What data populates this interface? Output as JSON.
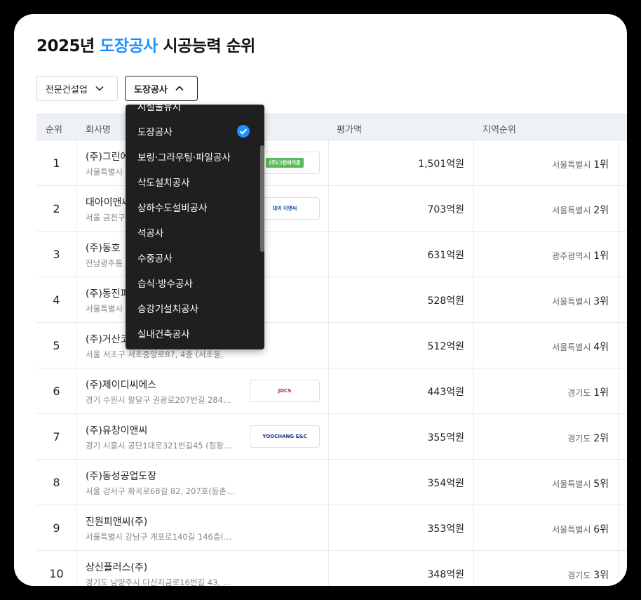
{
  "title": {
    "year": "2025년",
    "category": "도장공사",
    "suffix": "시공능력 순위"
  },
  "filters": {
    "industry": "전문건설업",
    "category": "도장공사"
  },
  "table": {
    "headers": {
      "rank": "순위",
      "company": "회사명",
      "amount": "평가액",
      "region_rank": "지역순위"
    },
    "rows": [
      {
        "rank": "1",
        "name": "(주)그린에",
        "addr": "서울특별시",
        "logo": "(주)그린에이존",
        "amount": "1,501억원",
        "region": "서울특별시",
        "region_rank": "1위"
      },
      {
        "rank": "2",
        "name": "대아이앤씨",
        "addr": "서울 금천구",
        "logo": "대아 이앤씨",
        "amount": "703억원",
        "region": "서울특별시",
        "region_rank": "2위"
      },
      {
        "rank": "3",
        "name": "(주)동호",
        "addr": "전남광주통",
        "logo": "",
        "amount": "631억원",
        "region": "광주광역시",
        "region_rank": "1위"
      },
      {
        "rank": "4",
        "name": "(주)동진피",
        "addr": "서울특별시",
        "logo": "",
        "amount": "528억원",
        "region": "서울특별시",
        "region_rank": "3위"
      },
      {
        "rank": "5",
        "name": "(주)거산코",
        "addr": "서울 서초구 서초중앙로87, 4층 (서초동,",
        "logo": "",
        "amount": "512억원",
        "region": "서울특별시",
        "region_rank": "4위"
      },
      {
        "rank": "6",
        "name": "(주)제이디씨에스",
        "addr": "경기 수원시 팔달구 권광로207번길 284…",
        "logo": "JDCS",
        "amount": "443억원",
        "region": "경기도",
        "region_rank": "1위"
      },
      {
        "rank": "7",
        "name": "(주)유창이앤씨",
        "addr": "경기 시흥시 공단1대로321번길45 (정왕…",
        "logo": "YOOCHANG E&C",
        "amount": "355억원",
        "region": "경기도",
        "region_rank": "2위"
      },
      {
        "rank": "8",
        "name": "(주)동성공업도장",
        "addr": "서울 강서구 화곡로68길 82, 207호(등촌…",
        "logo": "",
        "amount": "354억원",
        "region": "서울특별시",
        "region_rank": "5위"
      },
      {
        "rank": "9",
        "name": "진원피앤씨(주)",
        "addr": "서울특별시 강남구 개포로140길 146층(…",
        "logo": "",
        "amount": "353억원",
        "region": "서울특별시",
        "region_rank": "6위"
      },
      {
        "rank": "10",
        "name": "상신플러스(주)",
        "addr": "경기도 남양주시 다산지금로16번길 43, …",
        "logo": "",
        "amount": "348억원",
        "region": "경기도",
        "region_rank": "3위"
      }
    ]
  },
  "dropdown": {
    "items": [
      "시설물유지",
      "도장공사",
      "보링·그라우팅·파일공사",
      "삭도설치공사",
      "상하수도설비공사",
      "석공사",
      "수중공사",
      "습식·방수공사",
      "승강기설치공사",
      "실내건축공사"
    ],
    "selected": "도장공사"
  },
  "colors": {
    "accent": "#1e90ff",
    "dropdown_bg": "#1f1f1f",
    "header_bg": "#eef1f5"
  }
}
